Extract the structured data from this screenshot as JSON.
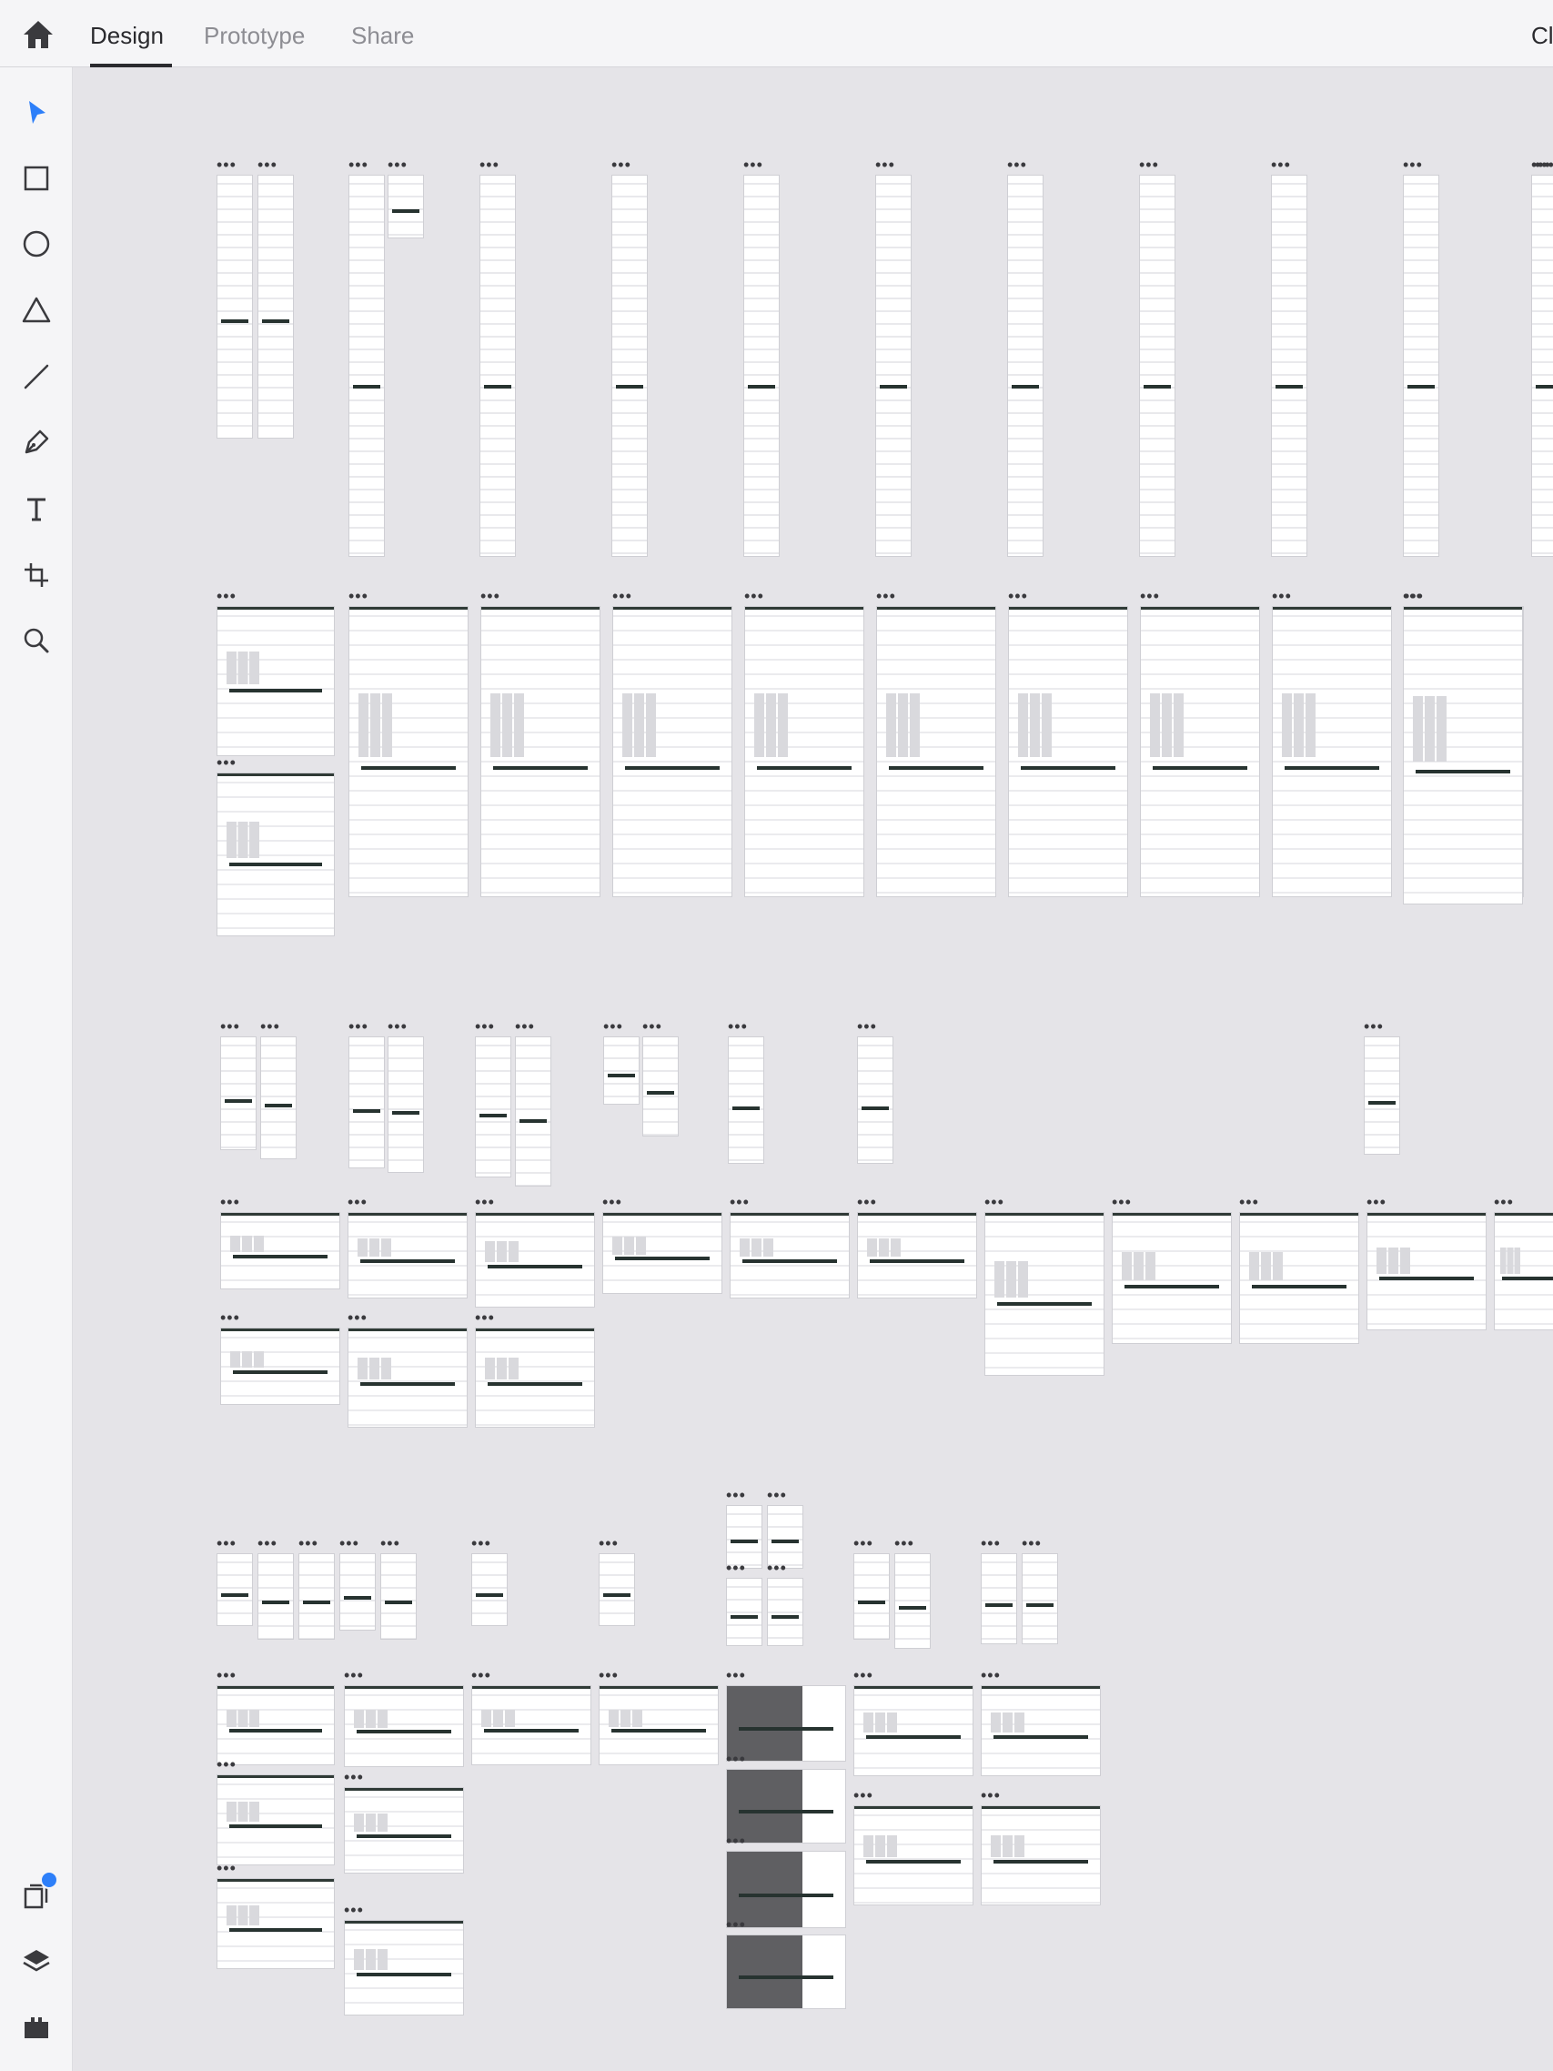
{
  "header": {
    "tabs": [
      {
        "label": "Design",
        "active": true
      },
      {
        "label": "Prototype",
        "active": false
      },
      {
        "label": "Share",
        "active": false
      }
    ],
    "truncated_right_label": "Cl"
  },
  "toolbar": {
    "tools": [
      "select-tool",
      "rectangle-tool",
      "ellipse-tool",
      "polygon-tool",
      "line-tool",
      "pen-tool",
      "text-tool",
      "artboard-tool",
      "zoom-tool"
    ],
    "bottom": [
      "assets-panel",
      "layers-panel",
      "plugins-panel"
    ],
    "active_tool": "select-tool",
    "notification_dot": true
  },
  "colors": {
    "accent": "#2d7ff9",
    "canvas": "#e5e4e8",
    "chrome": "#f5f5f7",
    "artboard_header": "#273330"
  },
  "canvas": {
    "artboard_menu_glyph": "•••"
  }
}
